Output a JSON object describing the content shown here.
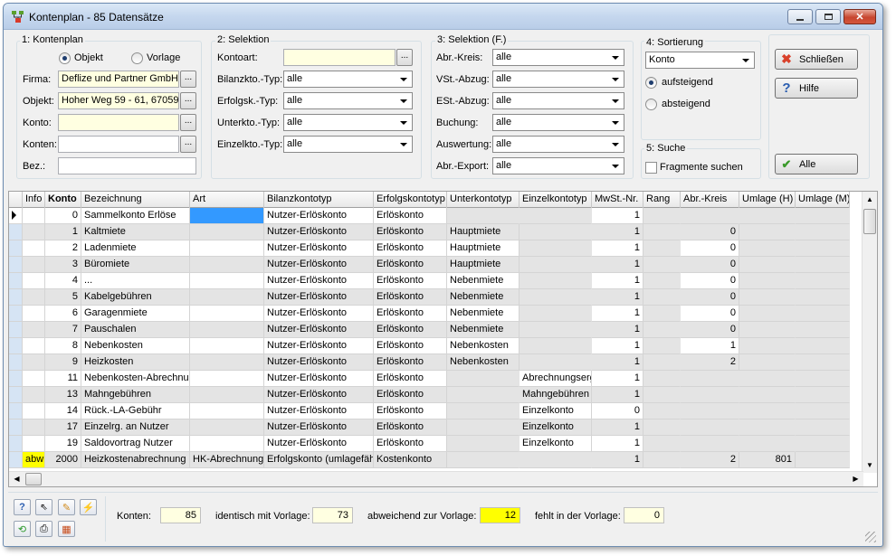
{
  "window": {
    "title": "Kontenplan - 85 Datensätze"
  },
  "group1": {
    "label": "1: Kontenplan",
    "radio_objekt": "Objekt",
    "radio_vorlage": "Vorlage",
    "firma_label": "Firma:",
    "firma_value": "Deflize und Partner GmbH",
    "objekt_label": "Objekt:",
    "objekt_value": "Hoher Weg 59 - 61, 67059",
    "konto_label": "Konto:",
    "konto_value": "",
    "konten_label": "Konten:",
    "konten_value": "",
    "bez_label": "Bez.:",
    "bez_value": "",
    "browse": "..."
  },
  "group2": {
    "label": "2: Selektion",
    "kontoart_label": "Kontoart:",
    "kontoart_value": "",
    "bilanz_label": "Bilanzkto.-Typ:",
    "bilanz_value": "alle",
    "erfolg_label": "Erfolgsk.-Typ:",
    "erfolg_value": "alle",
    "unter_label": "Unterkto.-Typ:",
    "unter_value": "alle",
    "einzel_label": "Einzelkto.-Typ:",
    "einzel_value": "alle"
  },
  "group3": {
    "label": "3: Selektion (F.)",
    "items": [
      {
        "label": "Abr.-Kreis:",
        "value": "alle"
      },
      {
        "label": "VSt.-Abzug:",
        "value": "alle"
      },
      {
        "label": "ESt.-Abzug:",
        "value": "alle"
      },
      {
        "label": "Buchung:",
        "value": "alle"
      },
      {
        "label": "Auswertung:",
        "value": "alle"
      },
      {
        "label": "Abr.-Export:",
        "value": "alle"
      }
    ]
  },
  "group4": {
    "label": "4: Sortierung",
    "sort_value": "Konto",
    "asc": "aufsteigend",
    "desc": "absteigend"
  },
  "group5": {
    "label": "5: Suche",
    "fragments": "Fragmente suchen"
  },
  "buttons": {
    "close": "Schließen",
    "help": "Hilfe",
    "all": "Alle"
  },
  "table": {
    "columns": [
      "Info",
      "Konto",
      "Bezeichnung",
      "Art",
      "Bilanzkontotyp",
      "Erfolgskontotyp",
      "Unterkontotyp",
      "Einzelkontotyp",
      "MwSt.-Nr.",
      "Rang",
      "Abr.-Kreis",
      "Umlage (H)",
      "Umlage (M)"
    ],
    "rows": [
      {
        "info": "",
        "konto": "0",
        "bez": "Sammelkonto Erlöse",
        "art": "",
        "bilanz": "Nutzer-Erlöskonto",
        "erfolg": "Erlöskonto",
        "unter": "",
        "einzel": "",
        "mwst": "1",
        "rang": "",
        "kreis": "",
        "uh": "",
        "um": ""
      },
      {
        "info": "",
        "konto": "1",
        "bez": "Kaltmiete",
        "art": "",
        "bilanz": "Nutzer-Erlöskonto",
        "erfolg": "Erlöskonto",
        "unter": "Hauptmiete",
        "einzel": "",
        "mwst": "1",
        "rang": "",
        "kreis": "0",
        "uh": "",
        "um": ""
      },
      {
        "info": "",
        "konto": "2",
        "bez": "Ladenmiete",
        "art": "",
        "bilanz": "Nutzer-Erlöskonto",
        "erfolg": "Erlöskonto",
        "unter": "Hauptmiete",
        "einzel": "",
        "mwst": "1",
        "rang": "",
        "kreis": "0",
        "uh": "",
        "um": ""
      },
      {
        "info": "",
        "konto": "3",
        "bez": "Büromiete",
        "art": "",
        "bilanz": "Nutzer-Erlöskonto",
        "erfolg": "Erlöskonto",
        "unter": "Hauptmiete",
        "einzel": "",
        "mwst": "1",
        "rang": "",
        "kreis": "0",
        "uh": "",
        "um": ""
      },
      {
        "info": "",
        "konto": "4",
        "bez": "...",
        "art": "",
        "bilanz": "Nutzer-Erlöskonto",
        "erfolg": "Erlöskonto",
        "unter": "Nebenmiete",
        "einzel": "",
        "mwst": "1",
        "rang": "",
        "kreis": "0",
        "uh": "",
        "um": ""
      },
      {
        "info": "",
        "konto": "5",
        "bez": "Kabelgebühren",
        "art": "",
        "bilanz": "Nutzer-Erlöskonto",
        "erfolg": "Erlöskonto",
        "unter": "Nebenmiete",
        "einzel": "",
        "mwst": "1",
        "rang": "",
        "kreis": "0",
        "uh": "",
        "um": ""
      },
      {
        "info": "",
        "konto": "6",
        "bez": "Garagenmiete",
        "art": "",
        "bilanz": "Nutzer-Erlöskonto",
        "erfolg": "Erlöskonto",
        "unter": "Nebenmiete",
        "einzel": "",
        "mwst": "1",
        "rang": "",
        "kreis": "0",
        "uh": "",
        "um": ""
      },
      {
        "info": "",
        "konto": "7",
        "bez": "Pauschalen",
        "art": "",
        "bilanz": "Nutzer-Erlöskonto",
        "erfolg": "Erlöskonto",
        "unter": "Nebenmiete",
        "einzel": "",
        "mwst": "1",
        "rang": "",
        "kreis": "0",
        "uh": "",
        "um": ""
      },
      {
        "info": "",
        "konto": "8",
        "bez": "Nebenkosten",
        "art": "",
        "bilanz": "Nutzer-Erlöskonto",
        "erfolg": "Erlöskonto",
        "unter": "Nebenkosten",
        "einzel": "",
        "mwst": "1",
        "rang": "",
        "kreis": "1",
        "uh": "",
        "um": ""
      },
      {
        "info": "",
        "konto": "9",
        "bez": "Heizkosten",
        "art": "",
        "bilanz": "Nutzer-Erlöskonto",
        "erfolg": "Erlöskonto",
        "unter": "Nebenkosten",
        "einzel": "",
        "mwst": "1",
        "rang": "",
        "kreis": "2",
        "uh": "",
        "um": ""
      },
      {
        "info": "",
        "konto": "11",
        "bez": "Nebenkosten-Abrechnur",
        "art": "",
        "bilanz": "Nutzer-Erlöskonto",
        "erfolg": "Erlöskonto",
        "unter": "",
        "einzel": "Abrechnungserg",
        "mwst": "1",
        "rang": "",
        "kreis": "",
        "uh": "",
        "um": ""
      },
      {
        "info": "",
        "konto": "13",
        "bez": "Mahngebühren",
        "art": "",
        "bilanz": "Nutzer-Erlöskonto",
        "erfolg": "Erlöskonto",
        "unter": "",
        "einzel": "Mahngebühren",
        "mwst": "1",
        "rang": "",
        "kreis": "",
        "uh": "",
        "um": ""
      },
      {
        "info": "",
        "konto": "14",
        "bez": "Rück.-LA-Gebühr",
        "art": "",
        "bilanz": "Nutzer-Erlöskonto",
        "erfolg": "Erlöskonto",
        "unter": "",
        "einzel": "Einzelkonto",
        "mwst": "0",
        "rang": "",
        "kreis": "",
        "uh": "",
        "um": ""
      },
      {
        "info": "",
        "konto": "17",
        "bez": "Einzelrg. an Nutzer",
        "art": "",
        "bilanz": "Nutzer-Erlöskonto",
        "erfolg": "Erlöskonto",
        "unter": "",
        "einzel": "Einzelkonto",
        "mwst": "1",
        "rang": "",
        "kreis": "",
        "uh": "",
        "um": ""
      },
      {
        "info": "",
        "konto": "19",
        "bez": "Saldovortrag Nutzer",
        "art": "",
        "bilanz": "Nutzer-Erlöskonto",
        "erfolg": "Erlöskonto",
        "unter": "",
        "einzel": "Einzelkonto",
        "mwst": "1",
        "rang": "",
        "kreis": "",
        "uh": "",
        "um": ""
      },
      {
        "info": "abw",
        "konto": "2000",
        "bez": "Heizkostenabrechnung",
        "art": "HK-Abrechnung",
        "bilanz": "Erfolgskonto (umlagefähi",
        "erfolg": "Kostenkonto",
        "unter": "",
        "einzel": "",
        "mwst": "1",
        "rang": "",
        "kreis": "2",
        "uh": "801",
        "um": ""
      }
    ]
  },
  "footer": {
    "konten_label": "Konten:",
    "konten_value": "85",
    "identisch_label": "identisch mit Vorlage:",
    "identisch_value": "73",
    "abweichend_label": "abweichend zur Vorlage:",
    "abweichend_value": "12",
    "fehlt_label": "fehlt in der Vorlage:",
    "fehlt_value": "0"
  },
  "colors": {
    "highlight_yellow": "#ffff00",
    "selected_blue": "#3399ff",
    "input_yellow": "#ffffe1"
  }
}
